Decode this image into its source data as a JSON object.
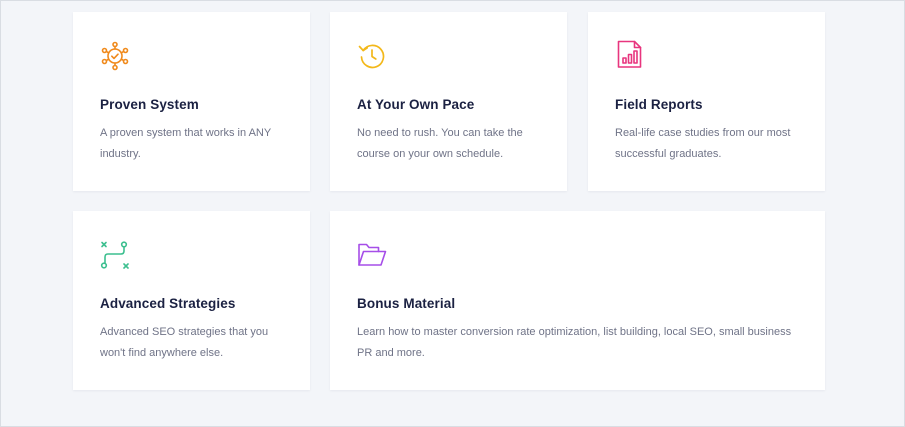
{
  "features": [
    {
      "icon": "gear-network-icon",
      "color": "#f08a1c",
      "title": "Proven System",
      "description": "A proven system that works in ANY industry."
    },
    {
      "icon": "clock-rewind-icon",
      "color": "#f3b81a",
      "title": "At Your Own Pace",
      "description": "No need to rush. You can take the course on your own schedule."
    },
    {
      "icon": "report-chart-icon",
      "color": "#e8357e",
      "title": "Field Reports",
      "description": "Real-life case studies from our most successful graduates."
    },
    {
      "icon": "strategy-path-icon",
      "color": "#3cbf8f",
      "title": "Advanced Strategies",
      "description": "Advanced SEO strategies that you won't find anywhere else."
    },
    {
      "icon": "folder-open-icon",
      "color": "#a64ee8",
      "title": "Bonus Material",
      "description": "Learn how to master conversion rate optimization, list building, local SEO, small business PR and more."
    }
  ]
}
